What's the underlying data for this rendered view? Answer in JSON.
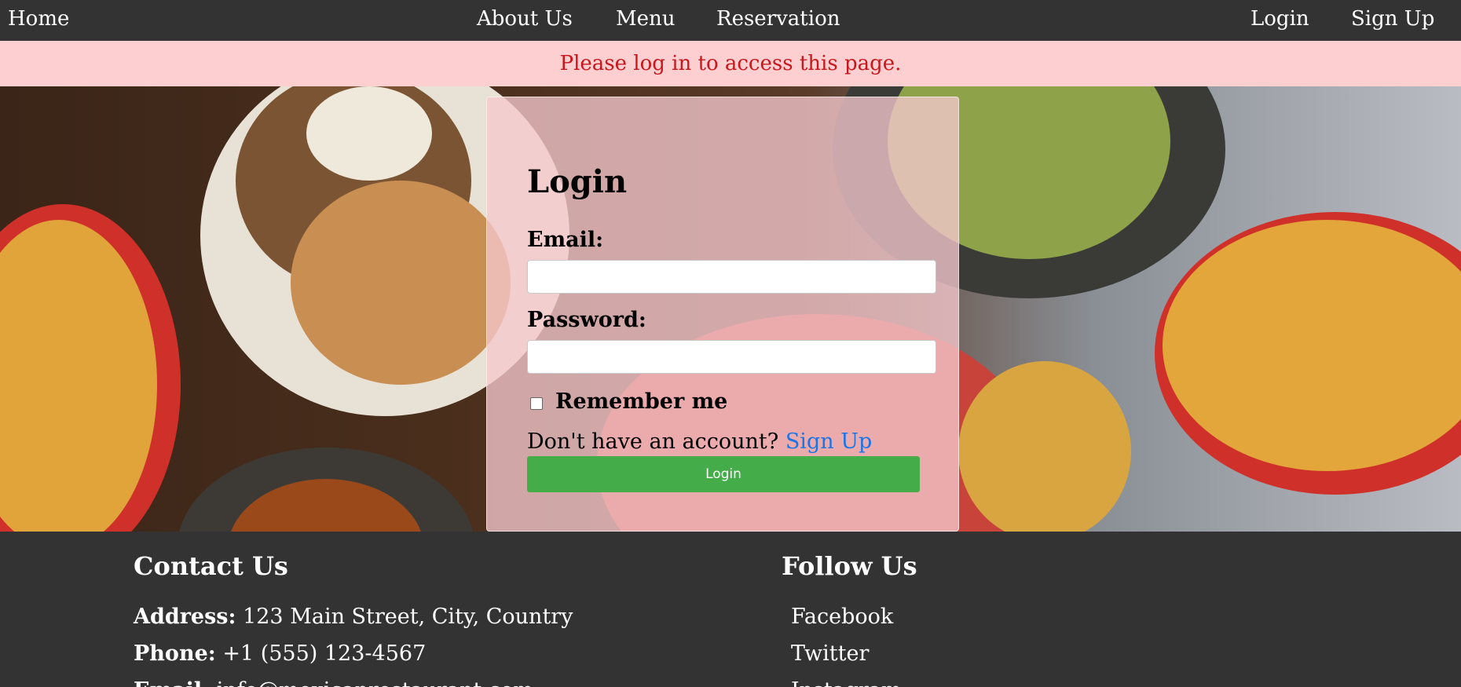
{
  "nav": {
    "home": "Home",
    "about": "About Us",
    "menu": "Menu",
    "reservation": "Reservation",
    "login": "Login",
    "signup": "Sign Up"
  },
  "alert": "Please log in to access this page.",
  "login_form": {
    "title": "Login",
    "email_label": "Email:",
    "email_value": "",
    "password_label": "Password:",
    "password_value": "",
    "remember_label": "Remember me",
    "remember_checked": false,
    "no_account_text": "Don't have an account?",
    "signup_link": "Sign Up",
    "submit_label": "Login"
  },
  "footer": {
    "contact_title": "Contact Us",
    "address_label": "Address:",
    "address_value": "123 Main Street, City, Country",
    "phone_label": "Phone:",
    "phone_value": "+1 (555) 123-4567",
    "email_label": "Email:",
    "email_value": "info@mexicanrestaurant.com",
    "follow_title": "Follow Us",
    "social": [
      "Facebook",
      "Twitter",
      "Instagram"
    ]
  },
  "colors": {
    "nav_bg": "#333333",
    "alert_bg": "#fdcfd0",
    "alert_text": "#c8171d",
    "button_green": "#45ac4a",
    "link_blue": "#1a75e6"
  }
}
